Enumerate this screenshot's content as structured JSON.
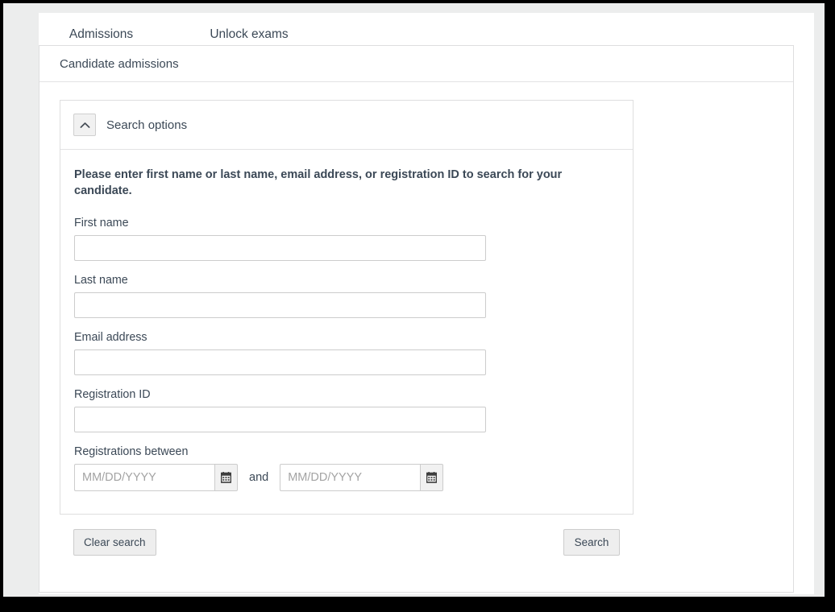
{
  "tabs": [
    {
      "label": "Admissions",
      "active": true
    },
    {
      "label": "Unlock exams",
      "active": false
    }
  ],
  "card": {
    "title": "Candidate admissions"
  },
  "search_panel": {
    "header_label": "Search options",
    "collapse_icon": "chevron-up-icon",
    "instructions": "Please enter first name or last name, email address, or registration ID to search for your candidate.",
    "fields": [
      {
        "label": "First name",
        "value": "",
        "placeholder": ""
      },
      {
        "label": "Last name",
        "value": "",
        "placeholder": ""
      },
      {
        "label": "Email address",
        "value": "",
        "placeholder": ""
      },
      {
        "label": "Registration ID",
        "value": "",
        "placeholder": ""
      }
    ],
    "date_range": {
      "label": "Registrations between",
      "separator": "and",
      "from": {
        "value": "",
        "placeholder": "MM/DD/YYYY",
        "icon": "calendar-icon"
      },
      "to": {
        "value": "",
        "placeholder": "MM/DD/YYYY",
        "icon": "calendar-icon"
      }
    },
    "footer": {
      "clear_label": "Clear search",
      "search_label": "Search"
    }
  },
  "colors": {
    "accent": "#0079ab",
    "text": "#3b4856",
    "border": "#dededf",
    "input_border": "#cccccc",
    "button_face": "#eeeeee",
    "gutter": "#eceded",
    "frame": "#000000"
  }
}
